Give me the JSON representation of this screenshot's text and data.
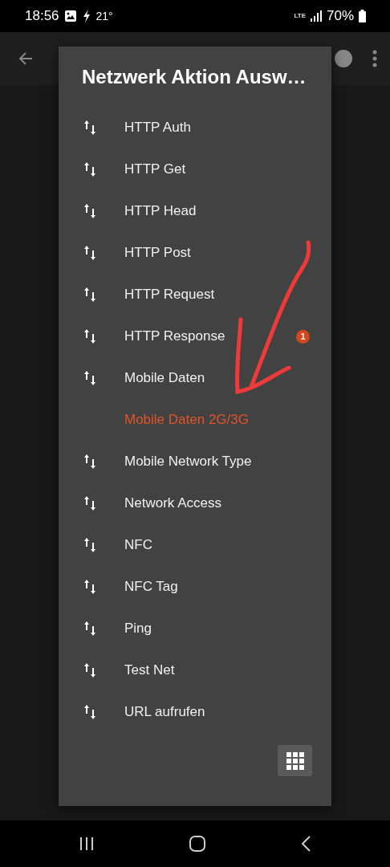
{
  "status_bar": {
    "time": "18:56",
    "temperature": "21°",
    "network": "LTE",
    "battery": "70%"
  },
  "dialog": {
    "title": "Netzwerk Aktion Ausw…",
    "items": [
      {
        "kind": "action",
        "label": "HTTP Auth"
      },
      {
        "kind": "action",
        "label": "HTTP Get"
      },
      {
        "kind": "action",
        "label": "HTTP Head"
      },
      {
        "kind": "action",
        "label": "HTTP Post"
      },
      {
        "kind": "action",
        "label": "HTTP Request"
      },
      {
        "kind": "action",
        "label": "HTTP Response",
        "badge": "1"
      },
      {
        "kind": "action",
        "label": "Mobile Daten"
      },
      {
        "kind": "unavailable",
        "label": "Mobile Daten 2G/3G"
      },
      {
        "kind": "action",
        "label": "Mobile Network Type"
      },
      {
        "kind": "action",
        "label": "Network Access"
      },
      {
        "kind": "action",
        "label": "NFC"
      },
      {
        "kind": "action",
        "label": "NFC Tag"
      },
      {
        "kind": "action",
        "label": "Ping"
      },
      {
        "kind": "action",
        "label": "Test Net"
      },
      {
        "kind": "action",
        "label": "URL aufrufen"
      }
    ]
  }
}
